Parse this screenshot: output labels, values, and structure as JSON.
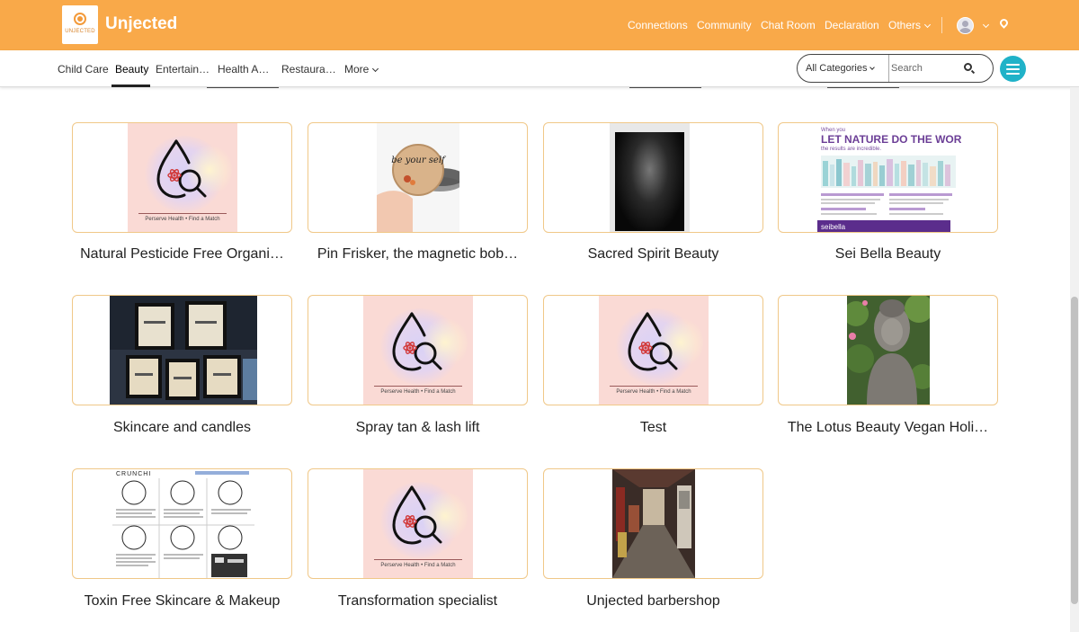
{
  "brand": {
    "logo_text": "UNJECTED",
    "name": "Unjected"
  },
  "topnav": {
    "items": [
      "Connections",
      "Community",
      "Chat Room",
      "Declaration",
      "Others"
    ],
    "icons": [
      "avatar-icon",
      "location-pin-icon"
    ]
  },
  "categories": {
    "items": [
      "Child Care",
      "Beauty",
      "Entertain…",
      "Health A…",
      "Restaura…",
      "More"
    ],
    "active": "Beauty"
  },
  "search": {
    "category_selected": "All Categories",
    "placeholder": "Search"
  },
  "placeholder_image": {
    "tagline": "Perserve Health • Find a Match"
  },
  "listings": [
    {
      "title": "Natural Pesticide Free Organi…",
      "image": "placeholder"
    },
    {
      "title": "Pin Frisker, the magnetic bob…",
      "image": "photo",
      "image_text": "be your self"
    },
    {
      "title": "Sacred Spirit Beauty",
      "image": "photo"
    },
    {
      "title": "Sei Bella Beauty",
      "image": "photo",
      "image_text": {
        "line1": "When you",
        "headline": "LET NATURE DO THE WORK,",
        "line3": "the results are incredible.",
        "logo": "seibella"
      }
    },
    {
      "title": "Skincare and candles",
      "image": "photo"
    },
    {
      "title": "Spray tan & lash lift",
      "image": "placeholder"
    },
    {
      "title": "Test",
      "image": "placeholder"
    },
    {
      "title": "The Lotus Beauty Vegan Holi…",
      "image": "photo"
    },
    {
      "title": "Toxin Free Skincare & Makeup",
      "image": "photo",
      "image_text": {
        "brand": "CRUNCHI"
      }
    },
    {
      "title": "Transformation specialist",
      "image": "placeholder"
    },
    {
      "title": "Unjected barbershop",
      "image": "photo"
    }
  ]
}
